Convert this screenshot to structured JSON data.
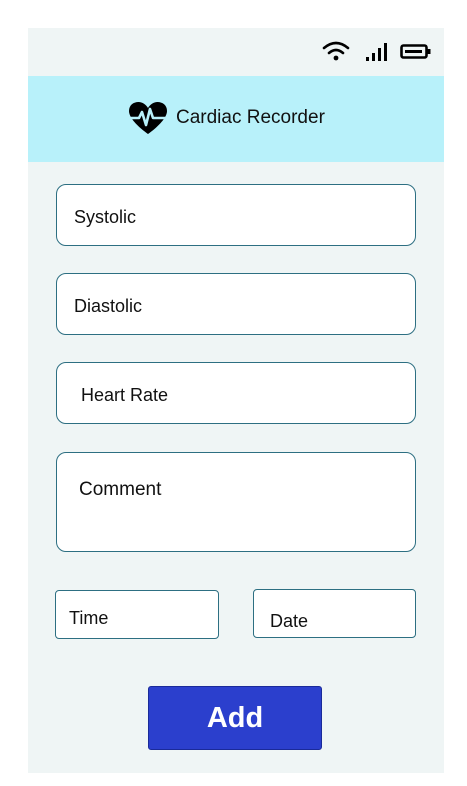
{
  "status_bar": {
    "icons": [
      "wifi-icon",
      "signal-icon",
      "battery-icon"
    ]
  },
  "header": {
    "icon": "heart-pulse-icon",
    "title": "Cardiac Recorder",
    "background": "#b8f1fa"
  },
  "form": {
    "systolic": {
      "placeholder": "Systolic"
    },
    "diastolic": {
      "placeholder": "Diastolic"
    },
    "heart_rate": {
      "placeholder": "Heart Rate"
    },
    "comment": {
      "placeholder": "Comment"
    },
    "time": {
      "placeholder": "Time"
    },
    "date": {
      "placeholder": "Date"
    }
  },
  "add_button": {
    "label": "Add",
    "color": "#2b3fcd"
  },
  "colors": {
    "page_background": "#eff5f5",
    "field_border": "#2d6f82"
  }
}
